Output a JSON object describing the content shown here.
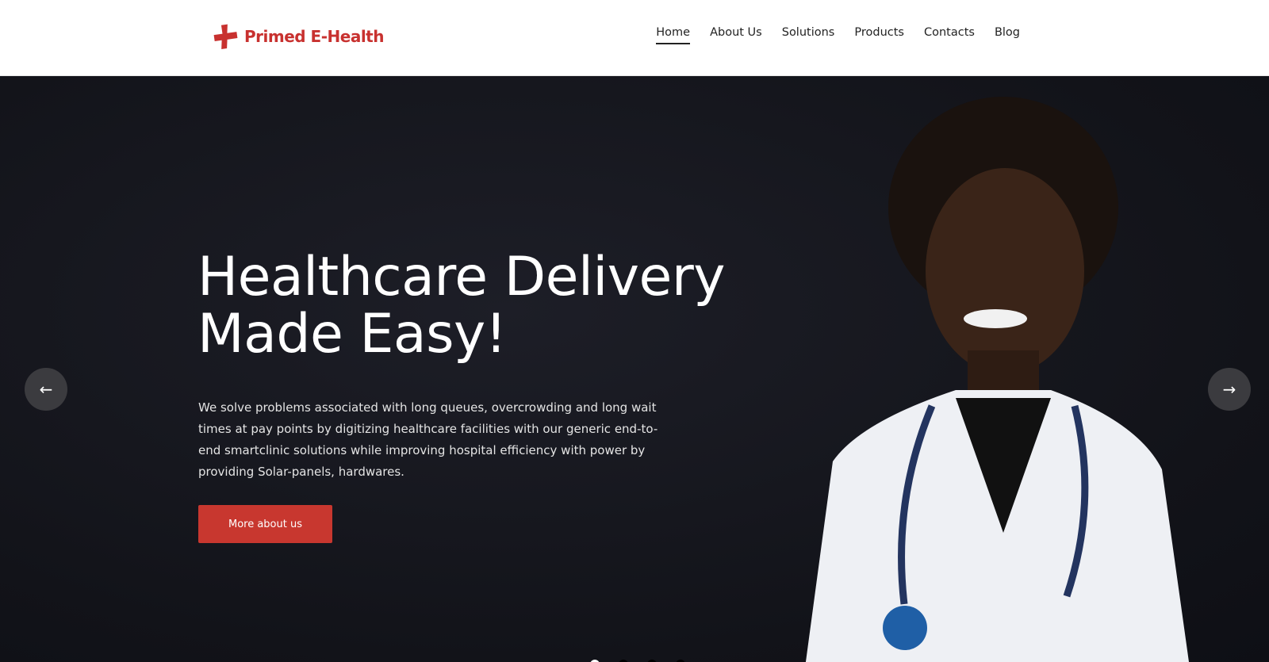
{
  "brand": {
    "name": "Primed E-Health",
    "color": "#c8312f"
  },
  "nav": [
    {
      "label": "Home",
      "active": true
    },
    {
      "label": "About Us"
    },
    {
      "label": "Solutions"
    },
    {
      "label": "Products"
    },
    {
      "label": "Contacts"
    },
    {
      "label": "Blog"
    }
  ],
  "hero": {
    "title_line1": "Healthcare Delivery",
    "title_line2": "Made Easy!",
    "description": "We solve problems associated with long queues, overcrowding and long wait times at pay points by digitizing healthcare facilities with our generic end-to-end smartclinic solutions while improving hospital efficiency with power by providing Solar-panels, hardwares.",
    "cta_label": "More about us",
    "prev_icon": "←",
    "next_icon": "→",
    "slides": 4,
    "active_slide": 1
  }
}
